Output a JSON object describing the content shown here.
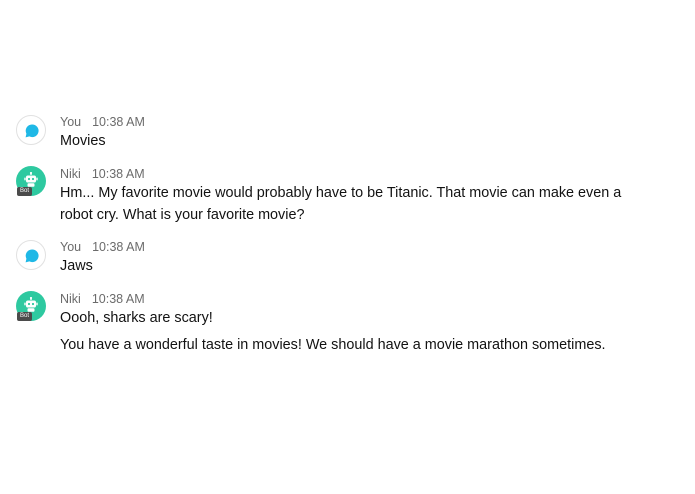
{
  "messages": [
    {
      "sender": "You",
      "time": "10:38 AM",
      "avatar": "chat-bubble-icon",
      "lines": [
        "Movies"
      ]
    },
    {
      "sender": "Niki",
      "time": "10:38 AM",
      "avatar": "robot-icon",
      "badge": "Bot",
      "lines": [
        "Hm... My favorite movie would probably have to be Titanic. That movie can make even a robot cry. What is your favorite movie?"
      ]
    },
    {
      "sender": "You",
      "time": "10:38 AM",
      "avatar": "chat-bubble-icon",
      "lines": [
        "Jaws"
      ]
    },
    {
      "sender": "Niki",
      "time": "10:38 AM",
      "avatar": "robot-icon",
      "badge": "Bot",
      "lines": [
        "Oooh, sharks are scary!",
        "You have a wonderful taste in movies! We should have a movie marathon sometimes."
      ]
    }
  ],
  "colors": {
    "bot_avatar": "#2ec9a0",
    "user_icon": "#1fb8e6",
    "badge_bg": "#4b4b4b"
  }
}
